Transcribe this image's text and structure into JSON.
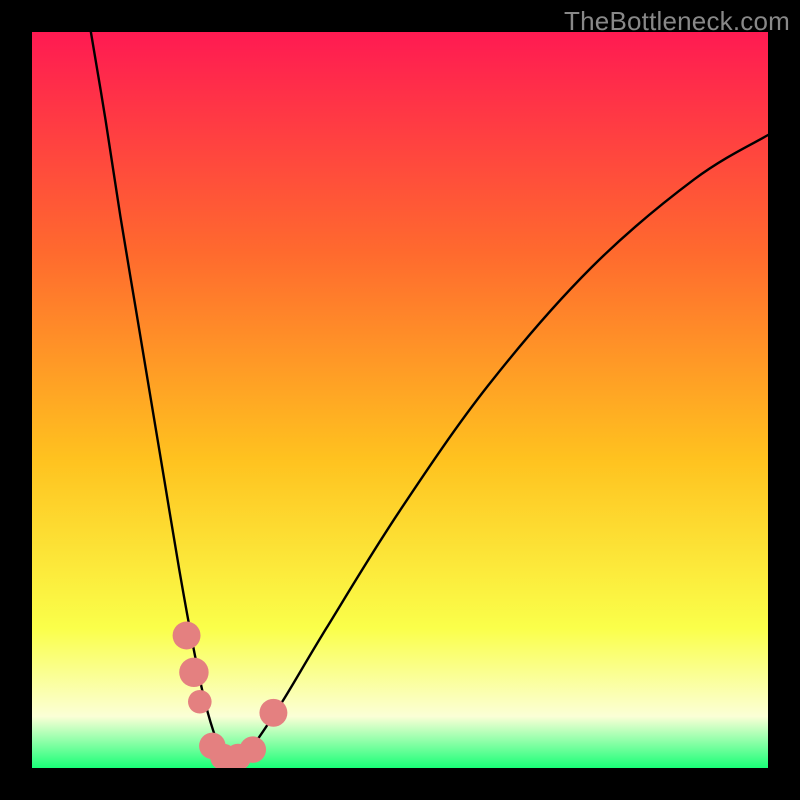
{
  "watermark": "TheBottleneck.com",
  "colors": {
    "frame": "#000000",
    "grad_top": "#ff1a52",
    "grad_mid_upper": "#ff6a2e",
    "grad_mid": "#ffc21f",
    "grad_lower": "#faff4a",
    "grad_pale": "#fbffd6",
    "grad_green": "#19ff77",
    "curve": "#000000",
    "marker": "#e48080"
  },
  "chart_data": {
    "type": "line",
    "title": "",
    "xlabel": "",
    "ylabel": "",
    "xlim": [
      0,
      100
    ],
    "ylim": [
      0,
      100
    ],
    "note": "No axes/ticks are rendered; values are relative percentages of plot area. y is 0 at bottom (good/green) and 100 at top (bad/red).",
    "series": [
      {
        "name": "bottleneck-curve",
        "x": [
          8,
          10,
          12,
          14,
          16,
          18,
          20,
          22,
          23.5,
          25,
          26.5,
          28,
          30,
          34,
          40,
          50,
          62,
          76,
          90,
          100
        ],
        "y": [
          100,
          88,
          75,
          63,
          51,
          39,
          27,
          16,
          9,
          4,
          1,
          1,
          3,
          9,
          19,
          35,
          52,
          68,
          80,
          86
        ]
      }
    ],
    "markers": [
      {
        "name": "left-cluster-1",
        "x": 21.0,
        "y": 18.0,
        "r": 1.9
      },
      {
        "name": "left-cluster-2",
        "x": 22.0,
        "y": 13.0,
        "r": 2.0
      },
      {
        "name": "left-cluster-3",
        "x": 22.8,
        "y": 9.0,
        "r": 1.6
      },
      {
        "name": "bottom-1",
        "x": 24.5,
        "y": 3.0,
        "r": 1.8
      },
      {
        "name": "bottom-2",
        "x": 26.0,
        "y": 1.5,
        "r": 1.8
      },
      {
        "name": "bottom-3",
        "x": 28.0,
        "y": 1.5,
        "r": 1.8
      },
      {
        "name": "bottom-4",
        "x": 30.0,
        "y": 2.5,
        "r": 1.8
      },
      {
        "name": "right-dot",
        "x": 32.8,
        "y": 7.5,
        "r": 1.9
      }
    ]
  }
}
